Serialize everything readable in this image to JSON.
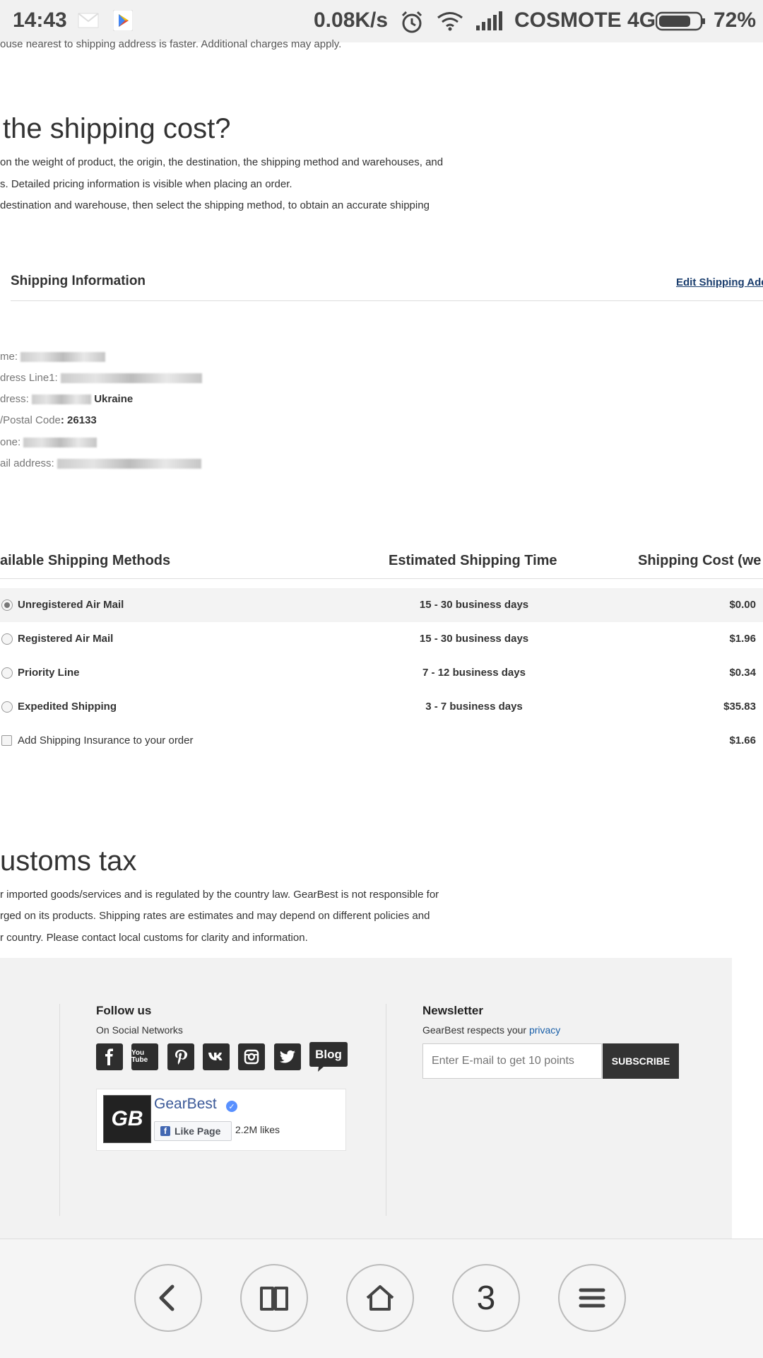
{
  "status_bar": {
    "time": "14:43",
    "net_speed": "0.08K/s",
    "carrier": "COSMOTE 4G",
    "battery": "72%"
  },
  "shipping_cost_section": {
    "intro_cut": "ouse nearest to shipping address is faster. Additional charges may apply.",
    "heading": "the shipping cost?",
    "para1": "on the weight of product, the origin, the destination, the shipping method and warehouses, and",
    "para2": "s. Detailed pricing information is visible when placing an order.",
    "para3": "destination and warehouse, then select the shipping method, to obtain an accurate shipping"
  },
  "shipping_info": {
    "title": "Shipping Information",
    "edit_link": "Edit Shipping Add",
    "rows": [
      {
        "label": "me:",
        "value": ""
      },
      {
        "label": "dress Line1:",
        "value": ""
      },
      {
        "label": "dress:",
        "value": "Ukraine"
      },
      {
        "label": "/Postal Code",
        "value": ": 26133"
      },
      {
        "label": "one:",
        "value": ""
      },
      {
        "label": "ail address:",
        "value": ""
      }
    ]
  },
  "methods_table": {
    "headers": {
      "method": "ailable Shipping Methods",
      "time": "Estimated Shipping Time",
      "cost": "Shipping Cost (we"
    },
    "rows": [
      {
        "name": "Unregistered Air Mail",
        "time": "15 - 30 business days",
        "cost": "$0.00",
        "selected": true
      },
      {
        "name": "Registered Air Mail",
        "time": "15 - 30 business days",
        "cost": "$1.96",
        "selected": false
      },
      {
        "name": "Priority Line",
        "time": "7 - 12 business days",
        "cost": "$0.34",
        "selected": false
      },
      {
        "name": "Expedited Shipping",
        "time": "3 - 7 business days",
        "cost": "$35.83",
        "selected": false
      }
    ],
    "insurance": {
      "label": "Add Shipping Insurance to your order",
      "cost": "$1.66"
    }
  },
  "customs_section": {
    "heading": "ustoms tax",
    "para1": "r imported goods/services and is regulated by the country law. GearBest is not responsible for",
    "para2": "rged on its products. Shipping rates are estimates and may depend on different policies and",
    "para3": "r country. Please contact local customs for clarity and information."
  },
  "footer": {
    "follow_title": "Follow us",
    "follow_sub": "On Social Networks",
    "social_icons": [
      "facebook-icon",
      "youtube-icon",
      "pinterest-icon",
      "vk-icon",
      "instagram-icon",
      "twitter-icon",
      "blog-icon"
    ],
    "blog_label": "Blog",
    "youtube_label": "You Tube",
    "fb_page": {
      "logo_text": "GB",
      "name": "GearBest",
      "like_label": "Like Page",
      "likes": "2.2M likes"
    },
    "newsletter_title": "Newsletter",
    "newsletter_sub": "GearBest respects your",
    "privacy_link": "privacy",
    "email_placeholder": "Enter E-mail to get 10 points",
    "subscribe_label": "SUBSCRIBE"
  },
  "browser_nav": {
    "tab_count": "3"
  }
}
